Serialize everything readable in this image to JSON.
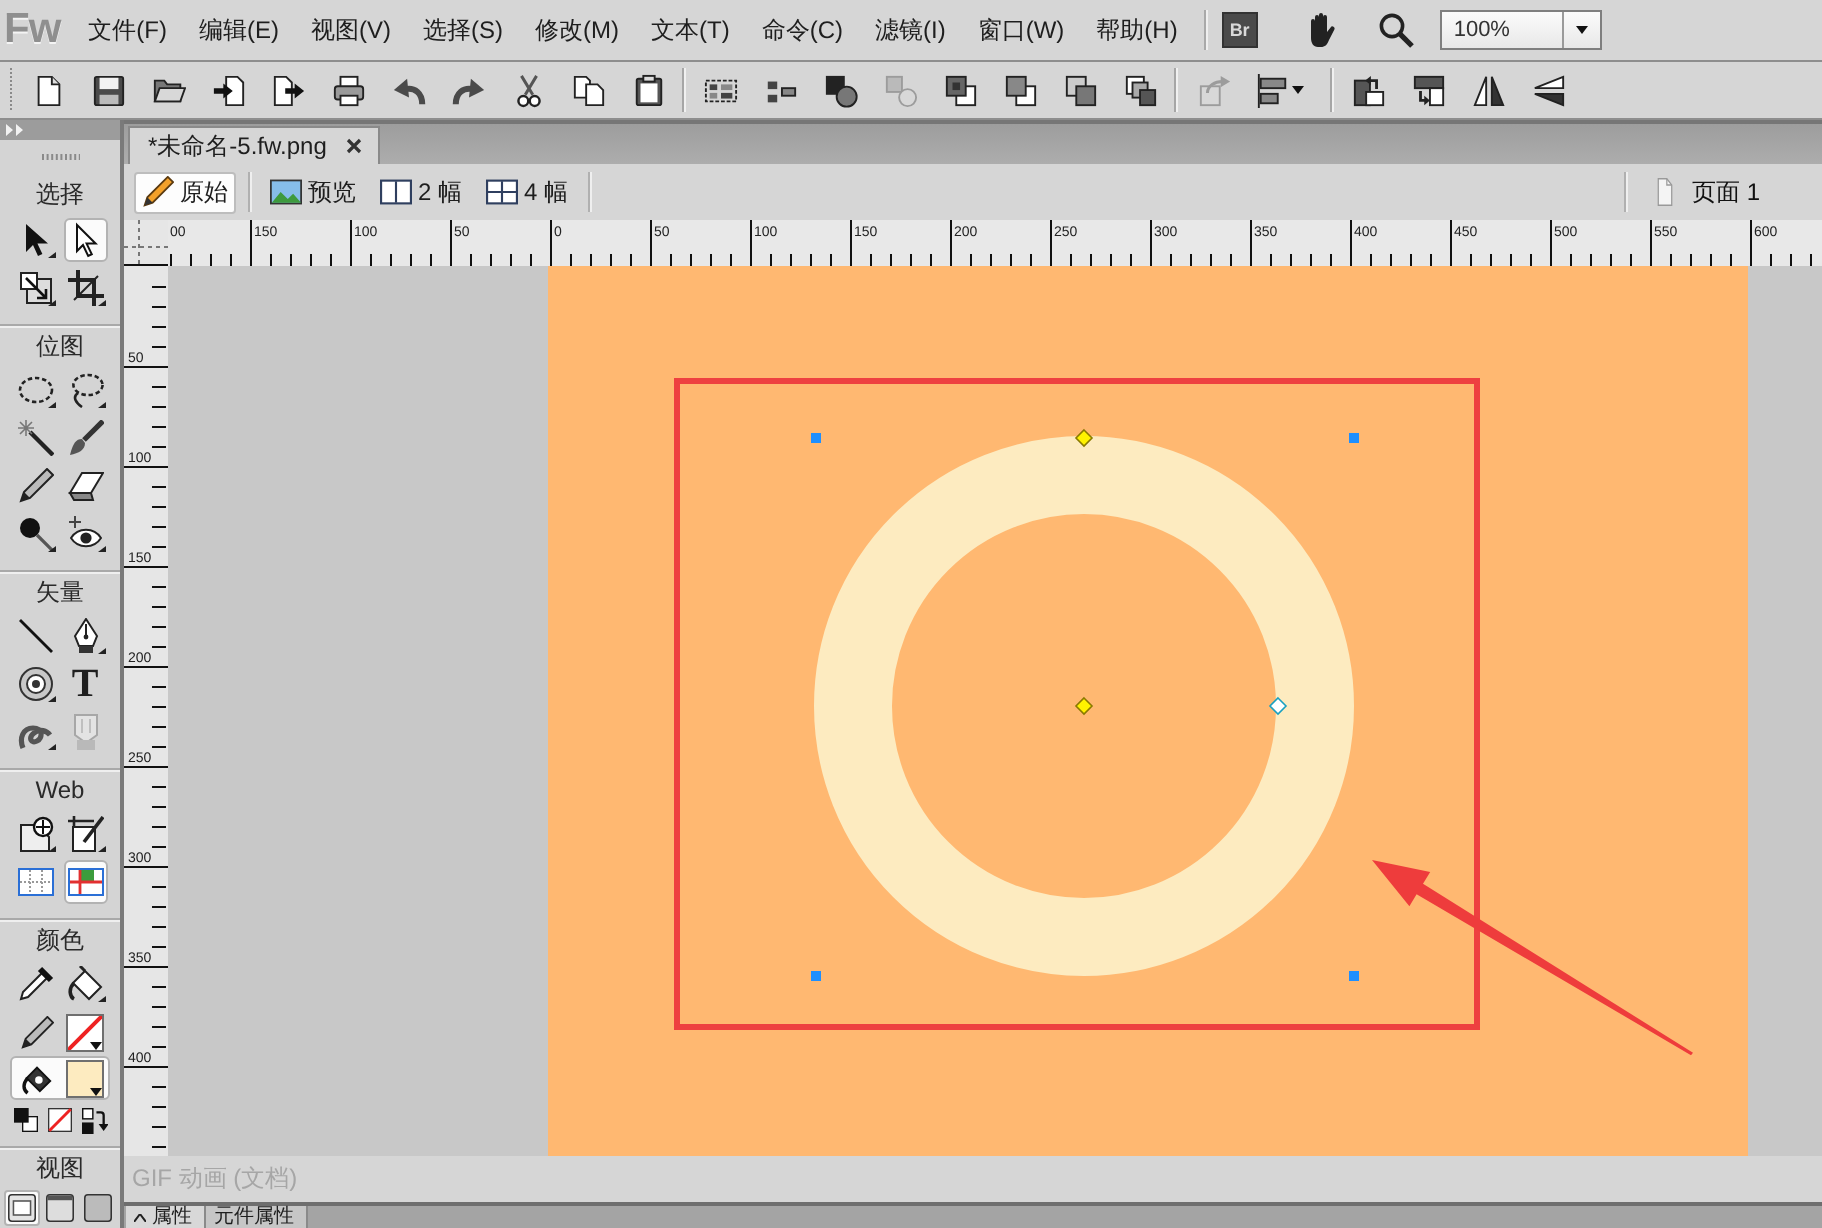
{
  "app": {
    "logo": "Fw"
  },
  "menu": [
    "文件(F)",
    "编辑(E)",
    "视图(V)",
    "选择(S)",
    "修改(M)",
    "文本(T)",
    "命令(C)",
    "滤镜(I)",
    "窗口(W)",
    "帮助(H)"
  ],
  "bridge": {
    "label": "Br"
  },
  "zoom": {
    "value": "100%"
  },
  "toolbar": [
    {
      "items": [
        {
          "kind": "new",
          "disabled": false
        },
        {
          "kind": "save",
          "disabled": false
        },
        {
          "kind": "open",
          "disabled": false
        },
        {
          "kind": "import",
          "disabled": false
        },
        {
          "kind": "export",
          "disabled": false
        },
        {
          "kind": "print",
          "disabled": false
        },
        {
          "kind": "undo",
          "disabled": false
        },
        {
          "kind": "redo",
          "disabled": false
        },
        {
          "kind": "cut",
          "disabled": false
        },
        {
          "kind": "copy",
          "disabled": false
        },
        {
          "kind": "paste",
          "disabled": false
        }
      ]
    },
    {
      "items": [
        {
          "kind": "group",
          "disabled": false
        },
        {
          "kind": "ungroup",
          "disabled": false
        },
        {
          "kind": "join",
          "disabled": false
        },
        {
          "kind": "split",
          "disabled": true
        },
        {
          "kind": "front",
          "disabled": false
        },
        {
          "kind": "forward",
          "disabled": false
        },
        {
          "kind": "backward",
          "disabled": false
        },
        {
          "kind": "back",
          "disabled": false
        }
      ]
    },
    {
      "items": [
        {
          "kind": "convert",
          "disabled": true
        },
        {
          "kind": "align",
          "disabled": false
        }
      ]
    },
    {
      "items": [
        {
          "kind": "rotate-left",
          "disabled": false
        },
        {
          "kind": "rotate-right",
          "disabled": false
        },
        {
          "kind": "flip-horizontal",
          "disabled": false
        },
        {
          "kind": "flip-vertical",
          "disabled": false
        }
      ]
    }
  ],
  "tools": {
    "sections": [
      {
        "kind": "tools",
        "title": "选择",
        "tools": [
          {
            "kind": "pointer",
            "selected": false,
            "flyout": true,
            "disabled": false
          },
          {
            "kind": "subselect",
            "selected": true,
            "flyout": false,
            "disabled": false
          },
          {
            "kind": "scale",
            "selected": false,
            "flyout": true,
            "disabled": false
          },
          {
            "kind": "crop",
            "selected": false,
            "flyout": true,
            "disabled": false
          }
        ]
      },
      {
        "kind": "tools",
        "title": "位图",
        "tools": [
          {
            "kind": "marquee",
            "selected": false,
            "flyout": true,
            "disabled": false
          },
          {
            "kind": "lasso",
            "selected": false,
            "flyout": true,
            "disabled": false
          },
          {
            "kind": "magic-wand",
            "selected": false,
            "flyout": false,
            "disabled": false
          },
          {
            "kind": "brush",
            "selected": false,
            "flyout": false,
            "disabled": false
          },
          {
            "kind": "pencil",
            "selected": false,
            "flyout": false,
            "disabled": false
          },
          {
            "kind": "eraser",
            "selected": false,
            "flyout": false,
            "disabled": false
          },
          {
            "kind": "blur",
            "selected": false,
            "flyout": true,
            "disabled": false
          },
          {
            "kind": "red-eye",
            "selected": false,
            "flyout": true,
            "disabled": false
          }
        ]
      },
      {
        "kind": "tools",
        "title": "矢量",
        "tools": [
          {
            "kind": "line",
            "selected": false,
            "flyout": false,
            "disabled": false
          },
          {
            "kind": "pen",
            "selected": false,
            "flyout": true,
            "disabled": false
          },
          {
            "kind": "shape",
            "selected": false,
            "flyout": true,
            "disabled": false
          },
          {
            "kind": "text",
            "label": "T",
            "selected": false,
            "flyout": false,
            "disabled": false
          },
          {
            "kind": "freeform",
            "selected": false,
            "flyout": true,
            "disabled": false
          },
          {
            "kind": "knife",
            "selected": false,
            "flyout": false,
            "disabled": true
          }
        ]
      },
      {
        "kind": "tools",
        "title": "Web",
        "tools": [
          {
            "kind": "hotspot",
            "selected": false,
            "flyout": true,
            "disabled": false
          },
          {
            "kind": "slice",
            "selected": false,
            "flyout": true,
            "disabled": false
          },
          {
            "kind": "hide-slices",
            "selected": false,
            "flyout": false,
            "disabled": false
          },
          {
            "kind": "show-slices",
            "selected": true,
            "flyout": false,
            "disabled": false
          }
        ]
      },
      {
        "kind": "colors",
        "title": "颜色",
        "tools": [
          {
            "kind": "eyedropper",
            "selected": false,
            "flyout": false,
            "disabled": false
          },
          {
            "kind": "bucket",
            "selected": false,
            "flyout": true,
            "disabled": false
          }
        ],
        "stroke": {
          "selected": false
        },
        "fill": {
          "selected": true,
          "color": "#fdebc0"
        }
      },
      {
        "kind": "view",
        "title": "视图",
        "tools": [
          {
            "kind": "standard-mode",
            "selected": true
          },
          {
            "kind": "menu-mode",
            "selected": false
          },
          {
            "kind": "full-mode",
            "selected": false
          }
        ]
      }
    ]
  },
  "document": {
    "tabs": [
      {
        "label": "*未命名-5.fw.png",
        "selected": true
      }
    ]
  },
  "views": [
    {
      "kind": "original",
      "label": "原始",
      "selected": true
    },
    {
      "kind": "preview",
      "label": "预览",
      "selected": false
    },
    {
      "kind": "two-up",
      "label": "2 幅",
      "selected": false
    },
    {
      "kind": "four-up",
      "label": "4 幅",
      "selected": false
    }
  ],
  "page": {
    "label": "页面 1"
  },
  "rulers": {
    "horizontal": [
      "00",
      "150",
      "100",
      "50",
      "0",
      "50",
      "100",
      "150",
      "200",
      "250",
      "300",
      "350",
      "400",
      "450",
      "500",
      "550",
      "600"
    ],
    "vertical": [
      "50",
      "100",
      "150",
      "200",
      "250",
      "300",
      "350",
      "400"
    ]
  },
  "canvas": {
    "ring": {
      "selected": true
    }
  },
  "status": "GIF 动画 (文档)",
  "panels": [
    {
      "label": "属性",
      "selected": true
    },
    {
      "label": "元件属性",
      "selected": false
    }
  ]
}
